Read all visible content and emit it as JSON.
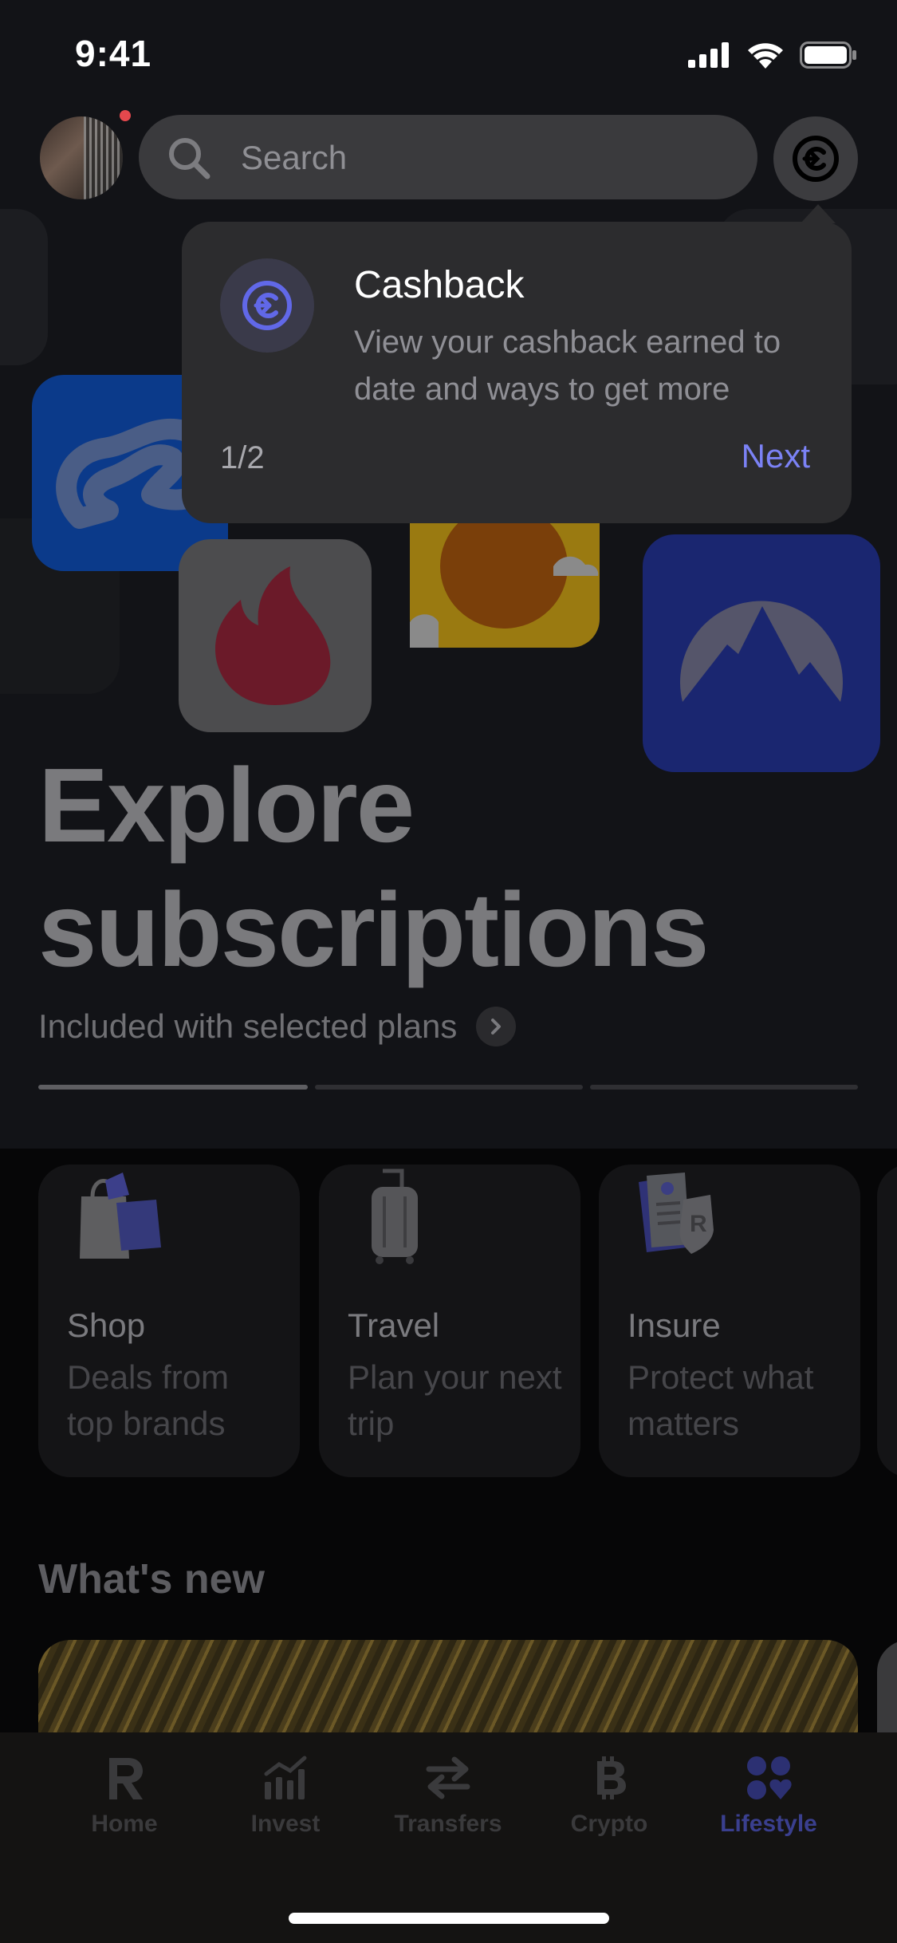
{
  "status_bar": {
    "time": "9:41"
  },
  "header": {
    "search_placeholder": "Search"
  },
  "hero": {
    "title_line1": "Explore",
    "title_line2": "subscriptions",
    "subtitle": "Included with selected plans",
    "pager": {
      "count": 3,
      "active_index": 0
    }
  },
  "categories": [
    {
      "title": "Shop",
      "desc": "Deals from top brands",
      "icon": "shopping-bags-icon"
    },
    {
      "title": "Travel",
      "desc": "Plan your next trip",
      "icon": "suitcase-icon"
    },
    {
      "title": "Insure",
      "desc": "Protect what matters",
      "icon": "insurance-documents-icon"
    }
  ],
  "whats_new": {
    "title": "What's new"
  },
  "tooltip": {
    "title": "Cashback",
    "description": "View your cashback earned to date and ways to get more",
    "step": "1/2",
    "next_label": "Next",
    "icon": "cashback-icon"
  },
  "tabs": [
    {
      "label": "Home",
      "icon": "revolut-r-icon",
      "active": false
    },
    {
      "label": "Invest",
      "icon": "chart-icon",
      "active": false
    },
    {
      "label": "Transfers",
      "icon": "transfer-arrows-icon",
      "active": false
    },
    {
      "label": "Crypto",
      "icon": "bitcoin-icon",
      "active": false
    },
    {
      "label": "Lifestyle",
      "icon": "lifestyle-icon",
      "active": true
    }
  ],
  "colors": {
    "accent": "#7b82f5",
    "tooltip_bg": "#2c2c2e",
    "notification_dot": "#e5484d"
  }
}
